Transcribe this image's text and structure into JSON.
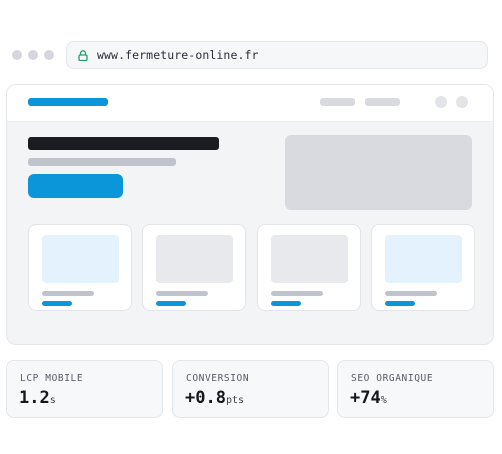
{
  "browser": {
    "url": "www.fermeture-online.fr"
  },
  "colors": {
    "accent": "#0a96d8",
    "lock_green": "#22a06b",
    "placeholder_gray": "#d8dae0",
    "light_blue": "#e3f2fc",
    "dark_bar": "#1a1c22"
  },
  "icons": {
    "window_controls": [
      "window-dot-icon",
      "window-dot-icon",
      "window-dot-icon"
    ],
    "lock": "lock-icon"
  },
  "metrics": [
    {
      "label": "LCP MOBILE",
      "value": "1.2",
      "unit": "s"
    },
    {
      "label": "CONVERSION",
      "value": "+0.8",
      "unit": "pts"
    },
    {
      "label": "SEO ORGANIQUE",
      "value": "+74",
      "unit": "%"
    }
  ]
}
